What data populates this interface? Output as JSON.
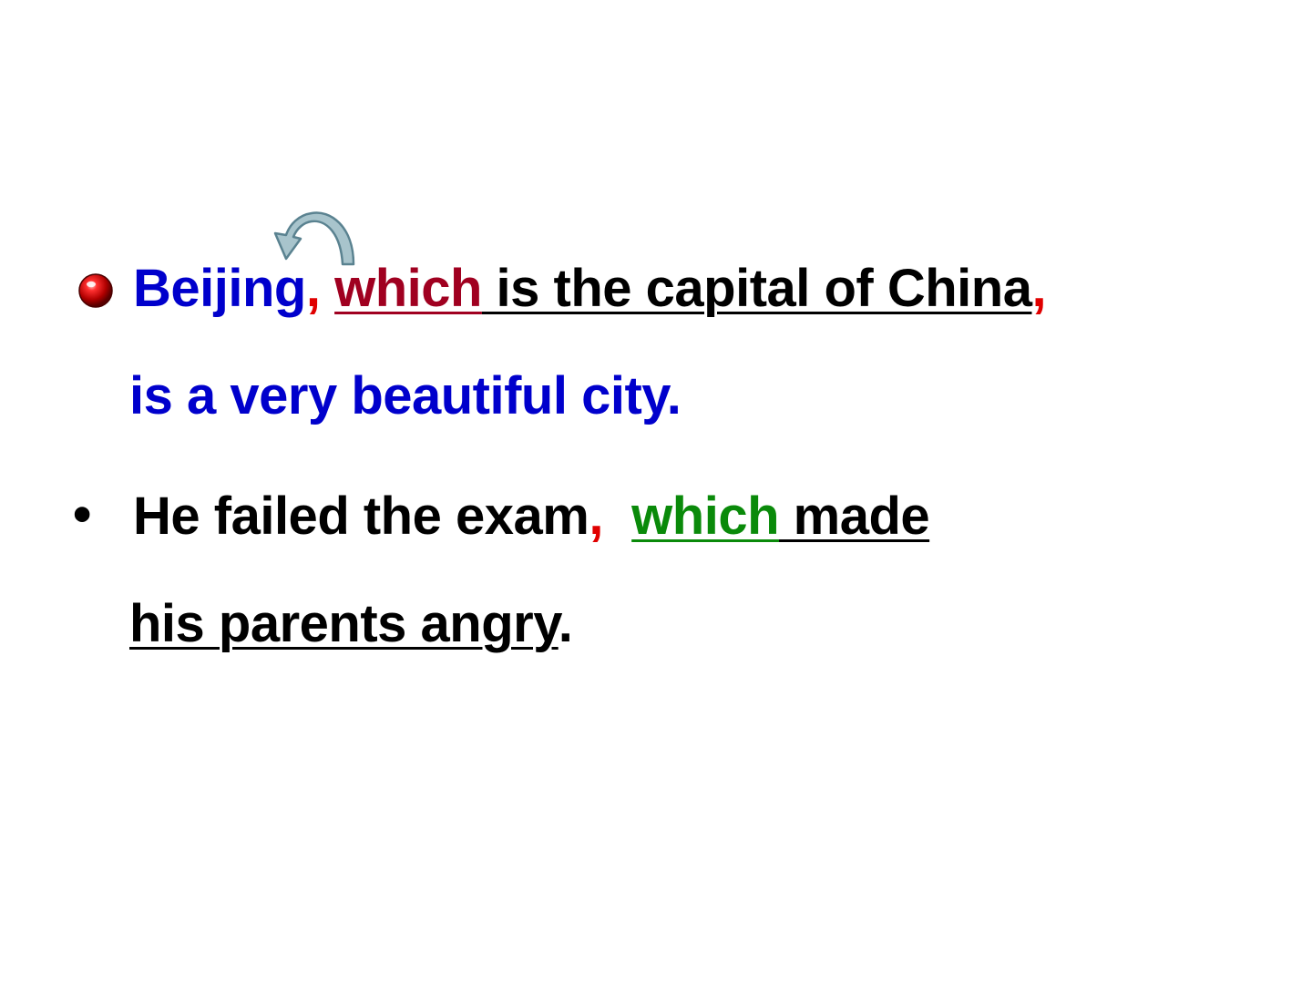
{
  "colors": {
    "blue": "#0000cc",
    "dark_red": "#a00020",
    "red": "#e00000",
    "green": "#0a8a0a",
    "black": "#000000",
    "arrow_fill": "#a8c4cc",
    "arrow_stroke": "#5a8290",
    "ball": "#c00000"
  },
  "sentence1": {
    "subject": "Beijing",
    "comma1": ",",
    "relative": "which",
    "clause": " is the capital of China",
    "comma2": ",",
    "rest": "is a very beautiful city."
  },
  "sentence2": {
    "bullet": "•",
    "main": "He failed the exam",
    "comma": ",",
    "relative": "which",
    "clause1": " made",
    "clause2": "his parents angry",
    "period": "."
  },
  "icons": {
    "bullet1": "red-ball-bullet-icon",
    "arrow": "curved-arrow-icon"
  }
}
